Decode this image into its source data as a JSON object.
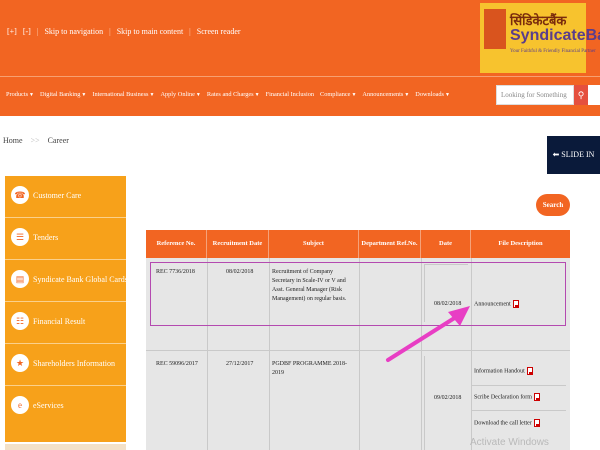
{
  "access_links": [
    "[+]",
    "[-]",
    "Skip to navigation",
    "Skip to main content",
    "Screen reader"
  ],
  "logo": {
    "hindi": "सिंडिकेटबैंक",
    "english": "SyndicateBank",
    "tagline": "Your Faithful & Friendly Financial Partner"
  },
  "nav_items": [
    "Products",
    "Digital Banking",
    "International Business",
    "Apply Online",
    "Rates and Charges",
    "Financial Inclusion",
    "Compliance",
    "Announcements",
    "Downloads"
  ],
  "search": {
    "placeholder": "Looking for Something"
  },
  "breadcrumb": {
    "home": "Home",
    "current": "Career"
  },
  "slide_in": "SLIDE IN",
  "sidebar": [
    "Customer Care",
    "Tenders",
    "Syndicate Bank Global Cards",
    "Financial Result",
    "Shareholders Information",
    "eServices"
  ],
  "search_button": "Search",
  "table": {
    "headers": [
      "Reference No.",
      "Recruitment Date",
      "Subject",
      "Department Ref.No.",
      "Date",
      "File Description"
    ],
    "row1": {
      "ref": "REC 7736/2018",
      "rdate": "08/02/2018",
      "subject": "Recruitment of Company Secretary in Scale-IV or V and Asst. General Manager (Risk Management) on regular basis.",
      "date": "08/02/2018",
      "doc": "Announcement"
    },
    "row2": {
      "ref": "REC 59096/2017",
      "rdate": "27/12/2017",
      "subject": "PGDBF PROGRAMME 2018-2019",
      "date": "09/02/2018",
      "docs": [
        "Information Handout",
        "Scribe Declaration form",
        "Download the call letter"
      ]
    }
  },
  "watermark": "Activate Windows"
}
